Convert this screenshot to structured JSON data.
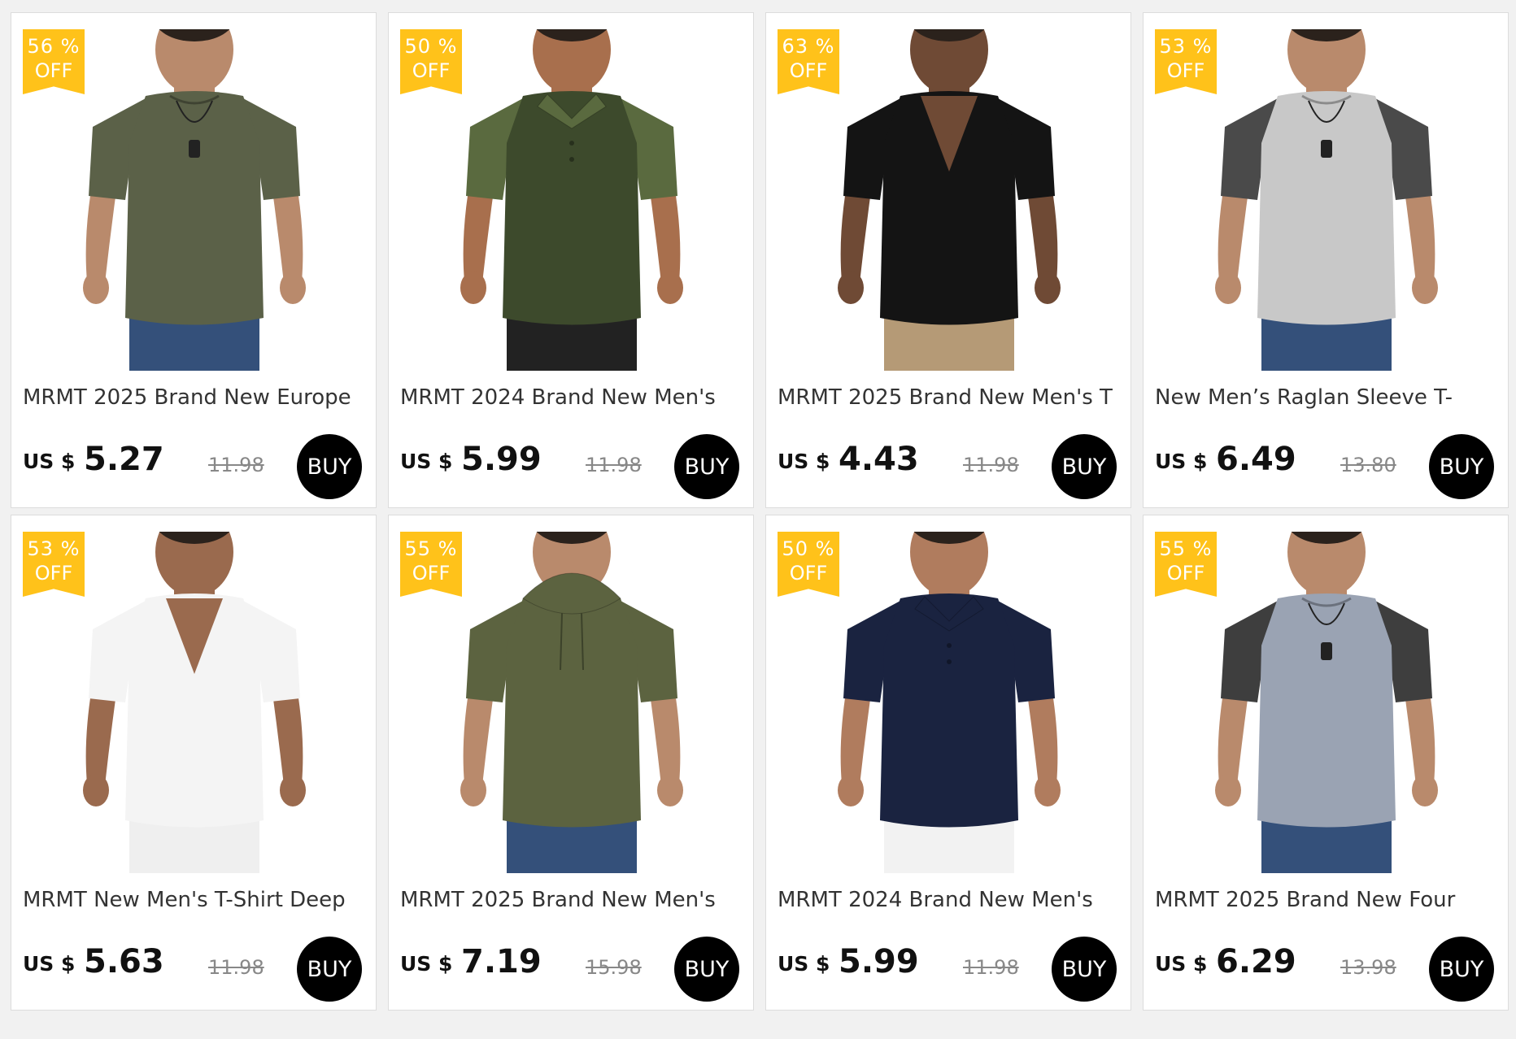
{
  "products": [
    {
      "discount_pct": "56 %",
      "discount_off": "OFF",
      "title": "MRMT 2025 Brand New Europe",
      "currency": "US $",
      "price": "5.27",
      "original_price": "11.98",
      "buy_label": "BUY",
      "shirt_color": "#5b6148",
      "sleeve_color": "#5b6148",
      "skin_color": "#b98a6c",
      "pants_color": "#34507a",
      "neck": "crew"
    },
    {
      "discount_pct": "50 %",
      "discount_off": "OFF",
      "title": "MRMT 2024 Brand New Men's",
      "currency": "US $",
      "price": "5.99",
      "original_price": "11.98",
      "buy_label": "BUY",
      "shirt_color": "#3d4a2c",
      "sleeve_color": "#5a6a3f",
      "skin_color": "#a86f4d",
      "pants_color": "#222222",
      "neck": "polo"
    },
    {
      "discount_pct": "63 %",
      "discount_off": "OFF",
      "title": "MRMT 2025 Brand New Men's T",
      "currency": "US $",
      "price": "4.43",
      "original_price": "11.98",
      "buy_label": "BUY",
      "shirt_color": "#141414",
      "sleeve_color": "#141414",
      "skin_color": "#6f4a35",
      "pants_color": "#b59a76",
      "neck": "vneck"
    },
    {
      "discount_pct": "53 %",
      "discount_off": "OFF",
      "title": "New Men’s Raglan Sleeve T-",
      "currency": "US $",
      "price": "6.49",
      "original_price": "13.80",
      "buy_label": "BUY",
      "shirt_color": "#c8c8c8",
      "sleeve_color": "#4a4a4a",
      "skin_color": "#b98a6c",
      "pants_color": "#34507a",
      "neck": "crew"
    },
    {
      "discount_pct": "53 %",
      "discount_off": "OFF",
      "title": "MRMT New Men's T-Shirt Deep",
      "currency": "US $",
      "price": "5.63",
      "original_price": "11.98",
      "buy_label": "BUY",
      "shirt_color": "#f4f4f4",
      "sleeve_color": "#f4f4f4",
      "skin_color": "#9a6a4e",
      "pants_color": "#efefef",
      "neck": "vneck"
    },
    {
      "discount_pct": "55 %",
      "discount_off": "OFF",
      "title": "MRMT 2025 Brand New Men's",
      "currency": "US $",
      "price": "7.19",
      "original_price": "15.98",
      "buy_label": "BUY",
      "shirt_color": "#5c6340",
      "sleeve_color": "#5c6340",
      "skin_color": "#b98a6c",
      "pants_color": "#34507a",
      "neck": "hood"
    },
    {
      "discount_pct": "50 %",
      "discount_off": "OFF",
      "title": "MRMT 2024 Brand New Men's",
      "currency": "US $",
      "price": "5.99",
      "original_price": "11.98",
      "buy_label": "BUY",
      "shirt_color": "#1a2340",
      "sleeve_color": "#1a2340",
      "skin_color": "#b07c5e",
      "pants_color": "#f2f2f2",
      "neck": "polo"
    },
    {
      "discount_pct": "55 %",
      "discount_off": "OFF",
      "title": "MRMT 2025 Brand New Four",
      "currency": "US $",
      "price": "6.29",
      "original_price": "13.98",
      "buy_label": "BUY",
      "shirt_color": "#9aa3b3",
      "sleeve_color": "#3e3e3e",
      "skin_color": "#b98a6c",
      "pants_color": "#34507a",
      "neck": "crew"
    }
  ]
}
